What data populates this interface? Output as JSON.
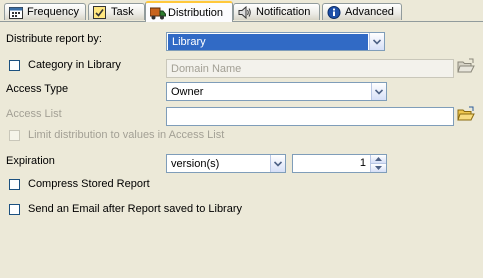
{
  "tabs": [
    {
      "label": "Frequency",
      "icon": "calendar-icon",
      "active": false
    },
    {
      "label": "Task",
      "icon": "task-icon",
      "active": false
    },
    {
      "label": "Distribution",
      "icon": "truck-icon",
      "active": true
    },
    {
      "label": "Notification",
      "icon": "speaker-icon",
      "active": false
    },
    {
      "label": "Advanced",
      "icon": "info-icon",
      "active": false
    }
  ],
  "form": {
    "distribute_by": {
      "label": "Distribute report by:",
      "value": "Library"
    },
    "category": {
      "label": "Category in Library",
      "checked": false,
      "placeholder": "Domain Name"
    },
    "access_type": {
      "label": "Access Type",
      "value": "Owner"
    },
    "access_list": {
      "label": "Access List",
      "value": ""
    },
    "limit_distribution": {
      "label": "Limit distribution to values in Access List",
      "checked": false,
      "disabled": true
    },
    "expiration": {
      "label": "Expiration",
      "unit": "version(s)",
      "count": "1"
    },
    "compress": {
      "label": "Compress Stored Report",
      "checked": false
    },
    "send_email": {
      "label": "Send an Email after Report saved to Library",
      "checked": false
    }
  },
  "colors": {
    "selection": "#316ac5",
    "active_tab_accent": "#ffc83c",
    "panel_bg": "#ece9d8"
  }
}
